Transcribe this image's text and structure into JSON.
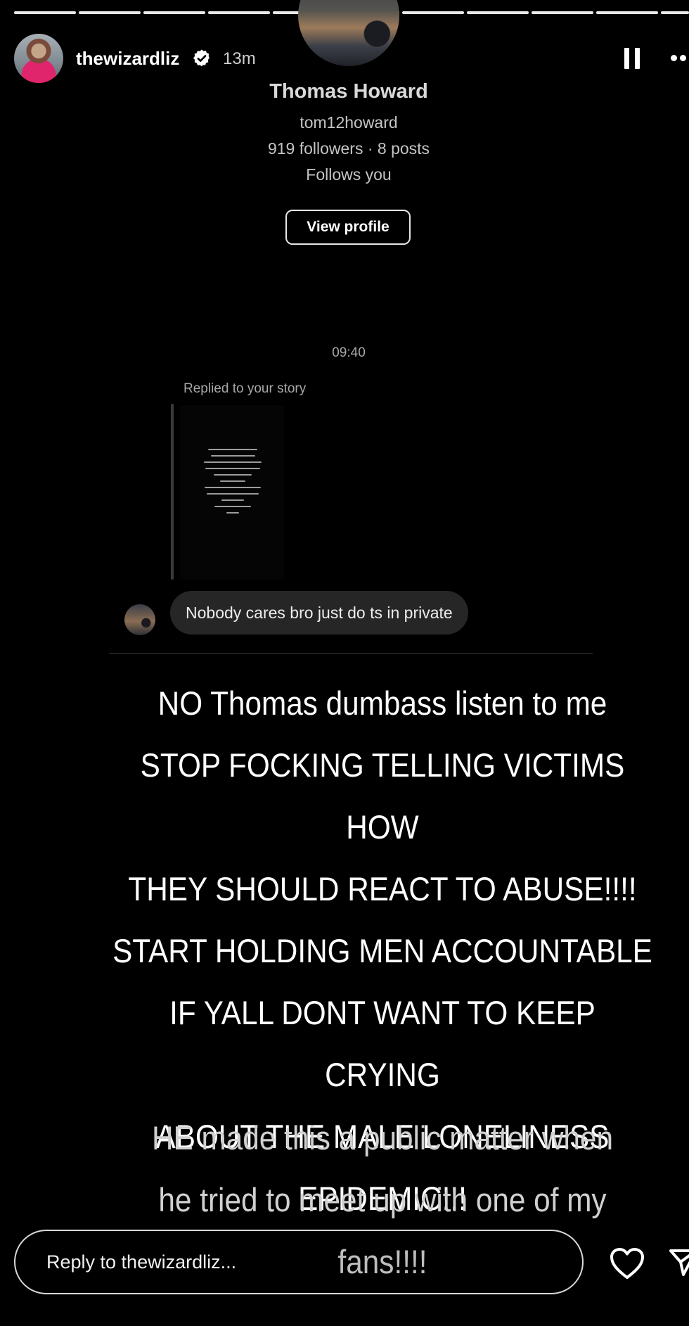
{
  "header": {
    "username": "thewizardliz",
    "time_ago": "13m",
    "verified_icon": "verified-badge-icon",
    "pause_icon": "pause-icon",
    "more_icon": "more-options-icon"
  },
  "dm_screenshot": {
    "profile": {
      "name": "Thomas Howard",
      "handle": "tom12howard",
      "stats": "919 followers · 8 posts",
      "relationship": "Follows you",
      "view_profile_label": "View profile"
    },
    "timestamp": "09:40",
    "replied_label": "Replied to your story",
    "message": "Nobody cares bro just do ts in private"
  },
  "caption": {
    "main_lines": [
      "NO Thomas dumbass listen to me",
      "STOP FOCKING TELLING VICTIMS HOW",
      "THEY SHOULD REACT TO ABUSE!!!!",
      "START HOLDING MEN ACCOUNTABLE",
      "IF YALL DONT WANT TO KEEP CRYING",
      "ABOUT THE MALE LONELINESS",
      "EPIDEMIC!!!"
    ],
    "sub_lines": [
      "HE  made this a public matter when",
      "he tried to meet up with one of my"
    ],
    "fade_line": "fans!!!!"
  },
  "footer": {
    "reply_placeholder": "Reply to thewizardliz...",
    "like_icon": "heart-icon",
    "share_icon": "send-icon"
  },
  "colors": {
    "background": "#000000",
    "bubble": "#262626",
    "secondary_text": "#a8a8a8"
  }
}
